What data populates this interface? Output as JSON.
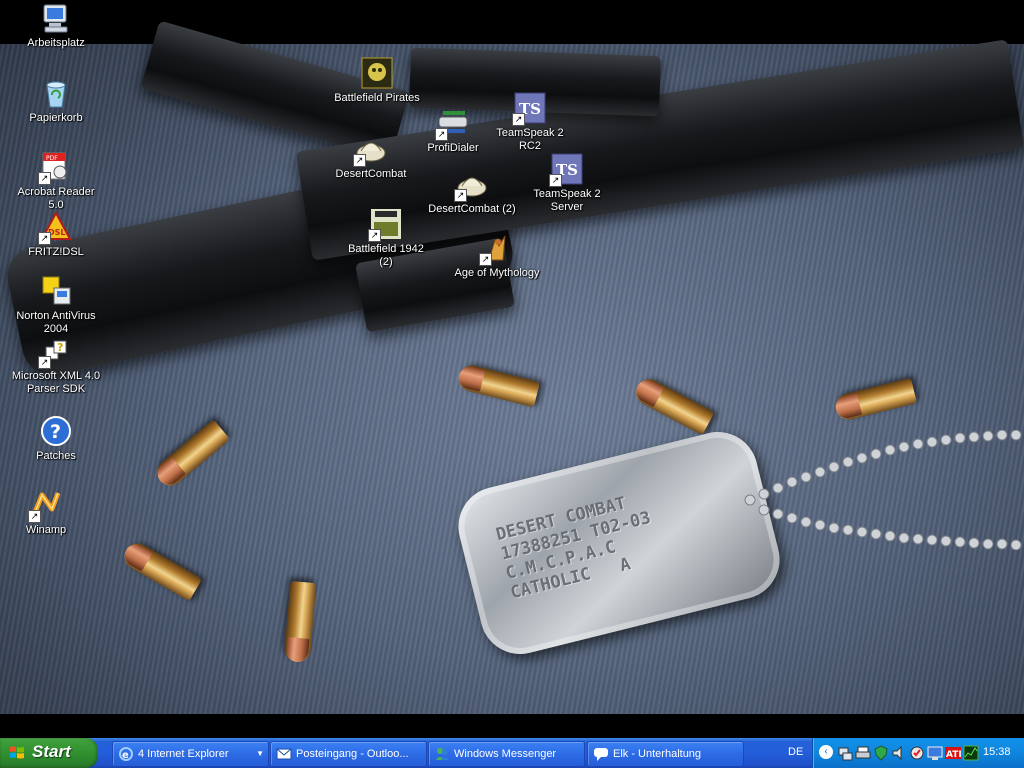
{
  "desktop": {
    "dogtag_text": "DESERT COMBAT\n17388251 T02-03\nC.M.C.P.A.C\nCATHOLIC   A",
    "icons": {
      "arbeitsplatz": "Arbeitsplatz",
      "papierkorb": "Papierkorb",
      "acrobat": "Acrobat Reader 5.0",
      "fritz": "FRITZ!DSL",
      "norton": "Norton AntiVirus 2004",
      "msxml": "Microsoft XML 4.0 Parser SDK",
      "patches": "Patches",
      "winamp": "Winamp",
      "bf_pirates": "Battlefield Pirates",
      "profidialer": "ProfiDialer",
      "ts_rc2": "TeamSpeak 2 RC2",
      "desertcombat": "DesertCombat",
      "ts_server": "TeamSpeak 2 Server",
      "desertcombat2": "DesertCombat (2)",
      "bf1942_2": "Battlefield 1942 (2)",
      "aom": "Age of Mythology"
    }
  },
  "taskbar": {
    "start_label": "Start",
    "tasks": [
      {
        "label": "4 Internet Explorer",
        "icon": "internet-explorer-icon"
      },
      {
        "label": "Posteingang - Outloo...",
        "icon": "outlook-icon"
      },
      {
        "label": "Windows Messenger",
        "icon": "messenger-icon"
      },
      {
        "label": "Elk - Unterhaltung",
        "icon": "chat-icon"
      }
    ],
    "language": "DE",
    "clock": "15:38"
  },
  "colors": {
    "taskbar": "#245edb",
    "start": "#3b9c38",
    "tray": "#0f86de"
  }
}
